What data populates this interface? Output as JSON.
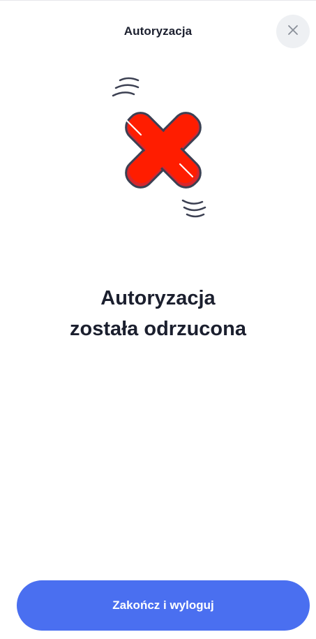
{
  "header": {
    "title": "Autoryzacja",
    "close_icon": "close-icon"
  },
  "illustration": {
    "icon": "rejected-x-icon",
    "colors": {
      "fill": "#ff1d00",
      "shadow": "#d8262b",
      "outline": "#3c4052"
    }
  },
  "message": {
    "line1": "Autoryzacja",
    "line2": "została odrzucona"
  },
  "actions": {
    "finish_logout_label": "Zakończ i wyloguj"
  },
  "colors": {
    "accent": "#4a6ff0",
    "background": "#ffffff",
    "text": "#1b1f2e",
    "close_bg": "#eef0f3"
  }
}
